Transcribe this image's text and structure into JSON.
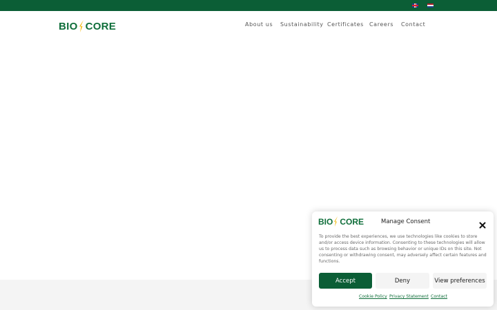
{
  "topbar": {
    "color": "#0b5e36",
    "languages": [
      {
        "icon": "flag-en-icon"
      },
      {
        "icon": "flag-nl-icon"
      }
    ]
  },
  "header": {
    "logo": {
      "left": "BIO",
      "right": "CORE"
    },
    "nav": [
      {
        "label": "About us"
      },
      {
        "label": "Sustainability"
      },
      {
        "label": "Certificates"
      },
      {
        "label": "Careers"
      },
      {
        "label": "Contact"
      }
    ]
  },
  "consent": {
    "logo": {
      "left": "BIO",
      "right": "CORE"
    },
    "title": "Manage Consent",
    "body": "To provide the best experiences, we use technologies like cookies to store and/or access device information. Consenting to these technologies will allow us to process data such as browsing behavior or unique IDs on this site. Not consenting or withdrawing consent, may adversely affect certain features and functions.",
    "buttons": {
      "accept": "Accept",
      "deny": "Deny",
      "preferences": "View preferences"
    },
    "links": {
      "cookie_policy": "Cookie Policy",
      "privacy": "Privacy Statement",
      "contact": "Contact"
    },
    "accent": "#0b5e36"
  }
}
